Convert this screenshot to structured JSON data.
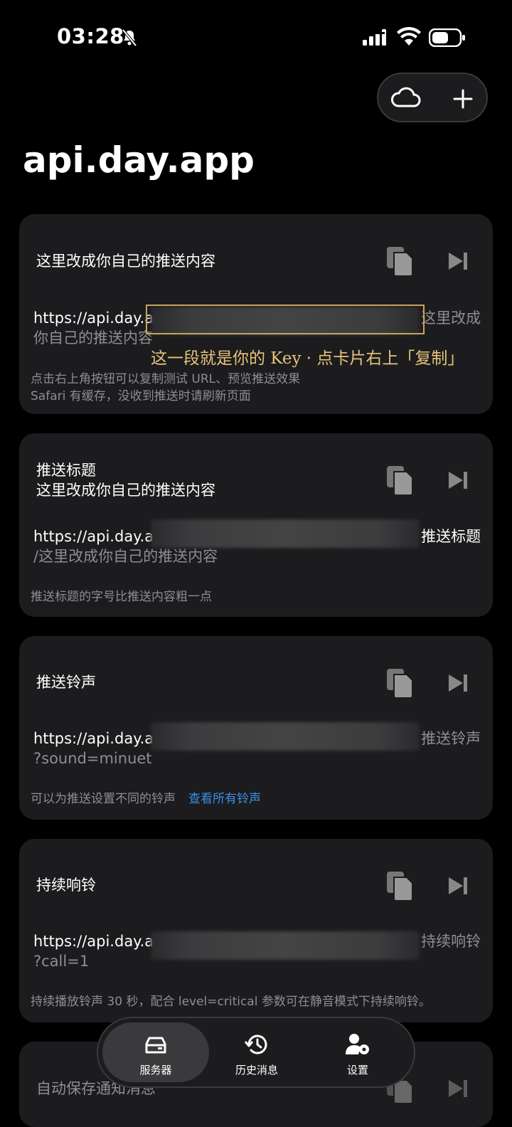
{
  "status_bar": {
    "time": "03:28"
  },
  "header": {
    "title": "api.day.app"
  },
  "cards": [
    {
      "title": "这里改成你自己的推送内容",
      "url_prefix": "https://api.day.a",
      "url_suffix": "这里改成",
      "url_line2": "你自己的推送内容",
      "description": "点击右上角按钮可以复制测试 URL、预览推送效果\nSafari 有缓存，没收到推送时请刷新页面"
    },
    {
      "title": "推送标题\n这里改成你自己的推送内容",
      "url_prefix": "https://api.day.a",
      "url_suffix": "推送标题",
      "url_line2": "/这里改成你自己的推送内容",
      "description": "推送标题的字号比推送内容粗一点"
    },
    {
      "title": "推送铃声",
      "url_prefix": "https://api.day.a",
      "url_suffix": "推送铃声",
      "url_line2": "?sound=minuet",
      "description": "可以为推送设置不同的铃声",
      "link": "查看所有铃声"
    },
    {
      "title": "持续响铃",
      "url_prefix": "https://api.day.a",
      "url_suffix": "持续响铃",
      "url_line2": "?call=1",
      "description": "持续播放铃声 30 秒，配合 level=critical 参数可在静音模式下持续响铃。"
    },
    {
      "title": "自动保存通知消息"
    }
  ],
  "annotation": {
    "text": "这一段就是你的 Key · 点卡片右上「复制」"
  },
  "tabbar": {
    "items": [
      {
        "label": "服务器",
        "icon": "server-icon",
        "active": true
      },
      {
        "label": "历史消息",
        "icon": "history-icon",
        "active": false
      },
      {
        "label": "设置",
        "icon": "settings-icon",
        "active": false
      }
    ]
  },
  "colors": {
    "background": "#000000",
    "card": "#1c1c1e",
    "link": "#3a8fe8",
    "annotation": "#e6c37a"
  }
}
